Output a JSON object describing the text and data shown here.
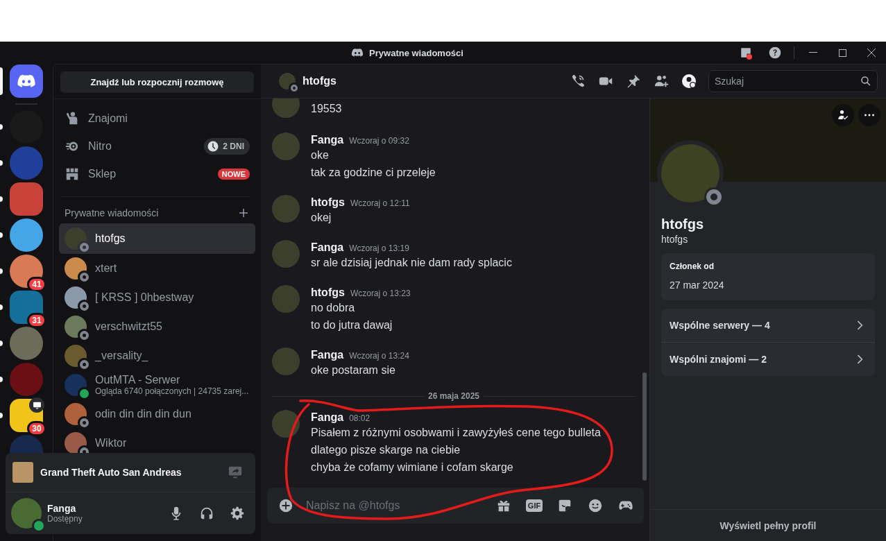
{
  "window": {
    "title": "Prywatne wiadomości",
    "inbox_unread": true
  },
  "server_rail": {
    "home": {
      "selected": true
    },
    "servers": [
      {
        "unread": true,
        "live": false
      },
      {
        "unread": true,
        "live": false
      },
      {
        "unread": true,
        "live": false
      },
      {
        "unread": true,
        "live": false
      },
      {
        "unread": true,
        "live": false,
        "badge": "41"
      },
      {
        "unread": true,
        "live": false,
        "badge": "31"
      },
      {
        "unread": true,
        "live": false
      },
      {
        "unread": true,
        "live": false
      },
      {
        "unread": true,
        "live": true,
        "badge": "30"
      },
      {
        "unread": false,
        "live": false
      }
    ]
  },
  "sidebar": {
    "search_button": "Znajdź lub rozpocznij rozmowę",
    "nav": [
      {
        "kind": "friends",
        "label": "Znajomi"
      },
      {
        "kind": "nitro",
        "label": "Nitro",
        "badge": "2 DNI"
      },
      {
        "kind": "shop",
        "label": "Sklep",
        "badge": "NOWE"
      }
    ],
    "dm_header": "Prywatne wiadomości",
    "dms": [
      {
        "name": "htofgs",
        "online": false,
        "selected": true
      },
      {
        "name": "xtert",
        "online": false,
        "selected": false
      },
      {
        "name": "[ KRSS ] 0hbestway",
        "online": false,
        "selected": false
      },
      {
        "name": "verschwitzt55",
        "online": false,
        "selected": false
      },
      {
        "name": "_versality_",
        "online": false,
        "selected": false
      },
      {
        "name": "OutMTA - Serwer",
        "subtitle": "Ogląda 6740 połączonych | 24735 zarej...",
        "online": true,
        "selected": false
      },
      {
        "name": "odin din din din dun",
        "online": false,
        "selected": false
      },
      {
        "name": "Wiktor",
        "online": false,
        "selected": false
      }
    ],
    "activity": {
      "game": "Grand Theft Auto San Andreas"
    },
    "user": {
      "name": "Fanga",
      "status_text": "Dostępny",
      "online": true
    }
  },
  "chat": {
    "header": {
      "name": "htofgs",
      "online": false,
      "profile_panel_open": true,
      "search_placeholder": "Szukaj"
    },
    "messages": [
      {
        "kind": "group",
        "lines": [
          "19553"
        ]
      },
      {
        "kind": "group",
        "author": "Fanga",
        "time": "Wczoraj o 09:32",
        "lines": [
          "oke",
          "tak za godzine ci przeleje"
        ]
      },
      {
        "kind": "group",
        "author": "htofgs",
        "time": "Wczoraj o 12:11",
        "lines": [
          "okej"
        ]
      },
      {
        "kind": "group",
        "author": "Fanga",
        "time": "Wczoraj o 13:19",
        "lines": [
          "sr ale dzisiaj jednak nie dam rady splacic"
        ]
      },
      {
        "kind": "group",
        "author": "htofgs",
        "time": "Wczoraj o 13:23",
        "lines": [
          "no dobra",
          "to do jutra dawaj"
        ]
      },
      {
        "kind": "group",
        "author": "Fanga",
        "time": "Wczoraj o 13:24",
        "lines": [
          "oke postaram  sie"
        ]
      },
      {
        "kind": "divider",
        "label": "26 maja 2025"
      },
      {
        "kind": "group",
        "author": "Fanga",
        "time": "08:02",
        "lines": [
          "Pisałem z różnymi osobwami i zawyżyłeś cene tego bulleta",
          "dlatego pisze skarge na ciebie",
          "chyba że cofamy wimiane i cofam skarge"
        ]
      }
    ],
    "composer": {
      "placeholder": "Napisz na @htofgs",
      "gif_label": "GIF"
    }
  },
  "profile": {
    "display_name": "htofgs",
    "username": "htofgs",
    "online": false,
    "member_since_label": "Członek od",
    "member_since": "27 mar 2024",
    "mutuals": [
      "Wspólne serwery — 4",
      "Wspólni znajomi — 2"
    ],
    "full_profile_link": "Wyświetl pełny profil"
  }
}
